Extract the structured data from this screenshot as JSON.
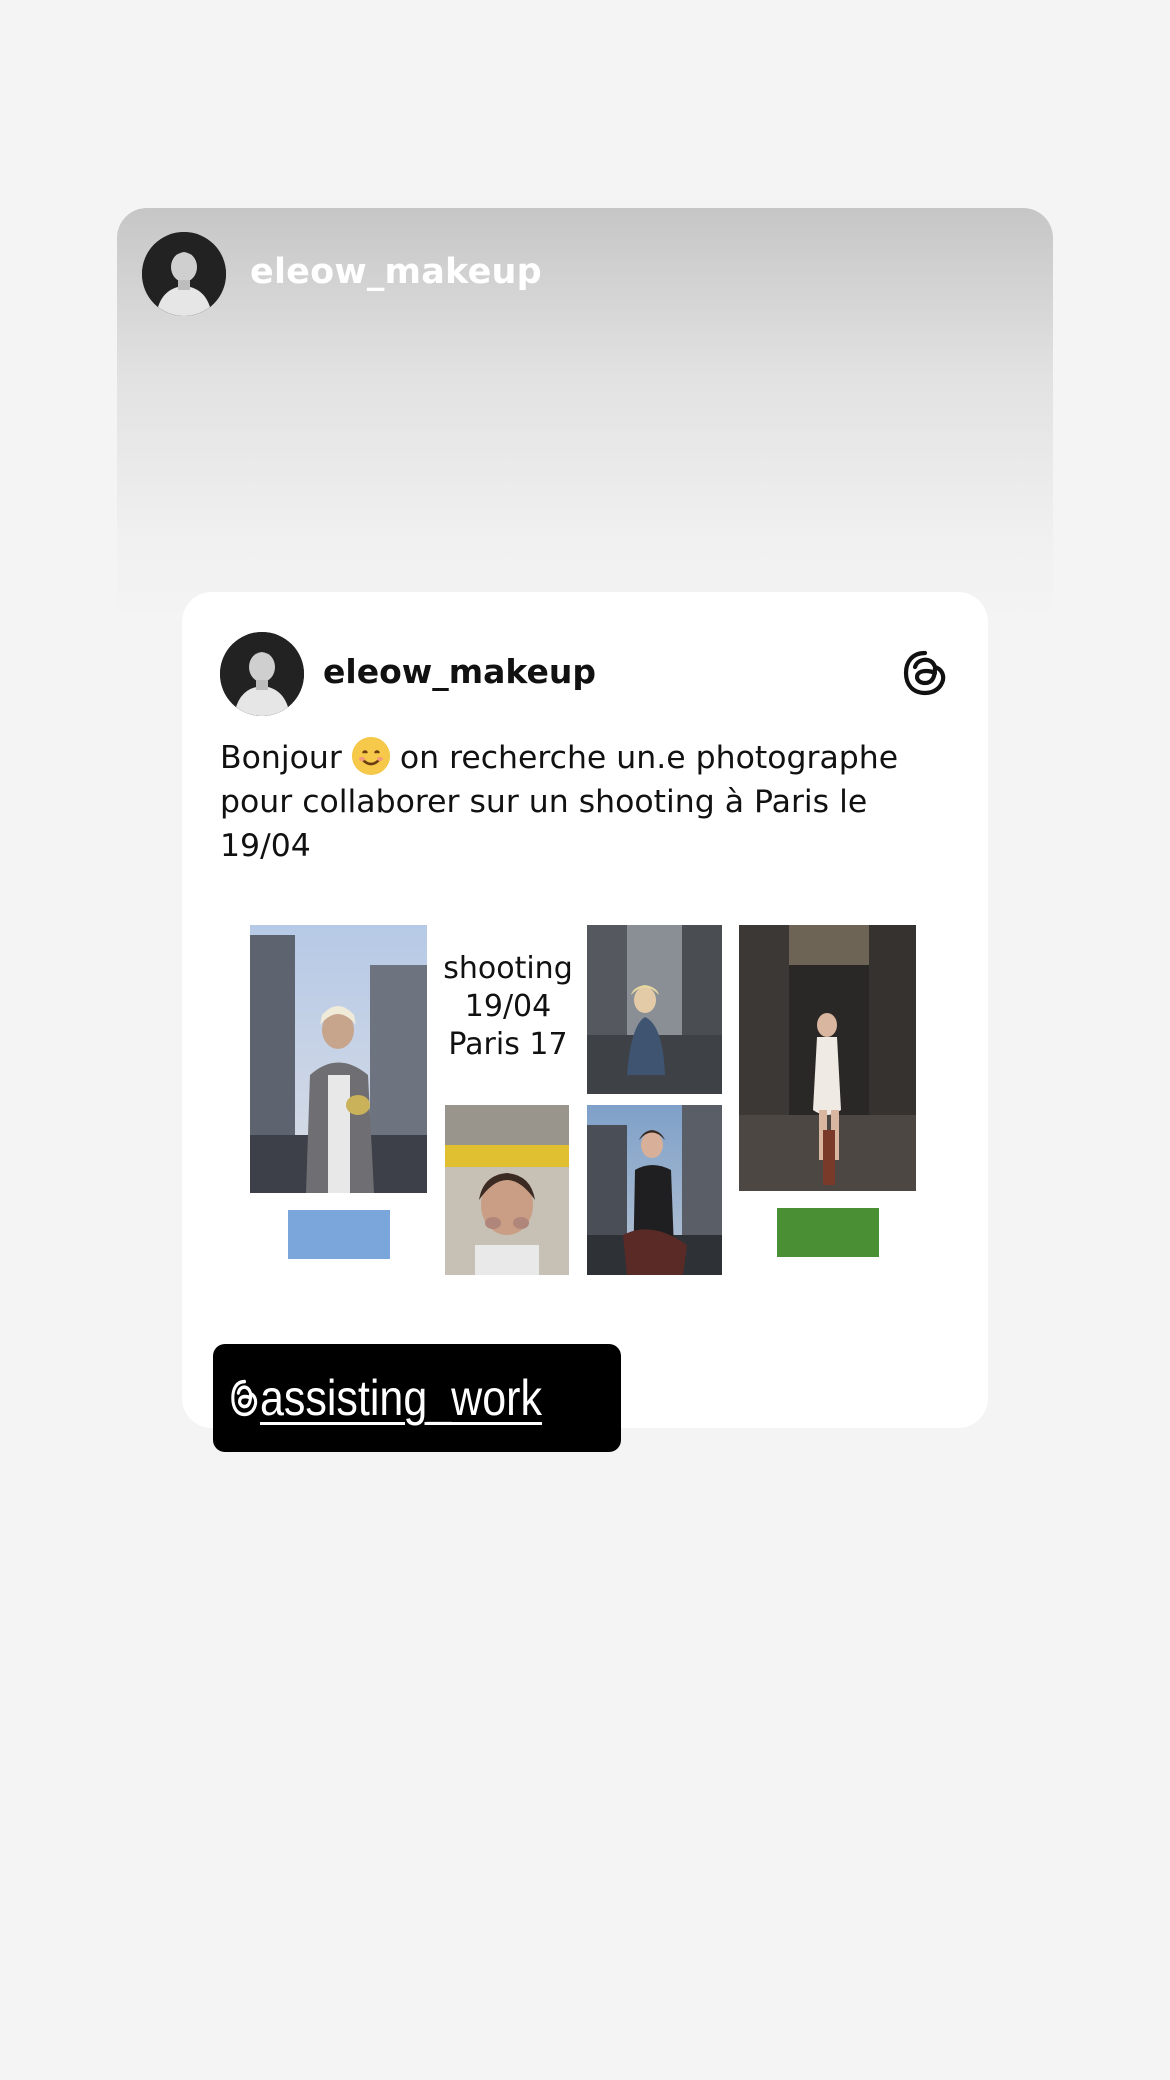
{
  "story": {
    "username": "eleow_makeup"
  },
  "post": {
    "username": "eleow_makeup",
    "text_line1_before_emoji": "Bonjour ",
    "text_line1_after_emoji": " on recherche un.e photographe",
    "text_line2": "pour collaborer sur un shooting à Paris le",
    "text_line3": "19/04",
    "emoji_name": "smiling-face-emoji",
    "platform_icon": "threads-icon"
  },
  "collage": {
    "line1": "shooting",
    "line2": "19/04",
    "line3": "Paris 17",
    "swatch_left_color": "#7aa6dc",
    "swatch_right_color": "#4a8f34"
  },
  "mention": {
    "handle": "assisting_work",
    "icon": "threads-icon"
  }
}
